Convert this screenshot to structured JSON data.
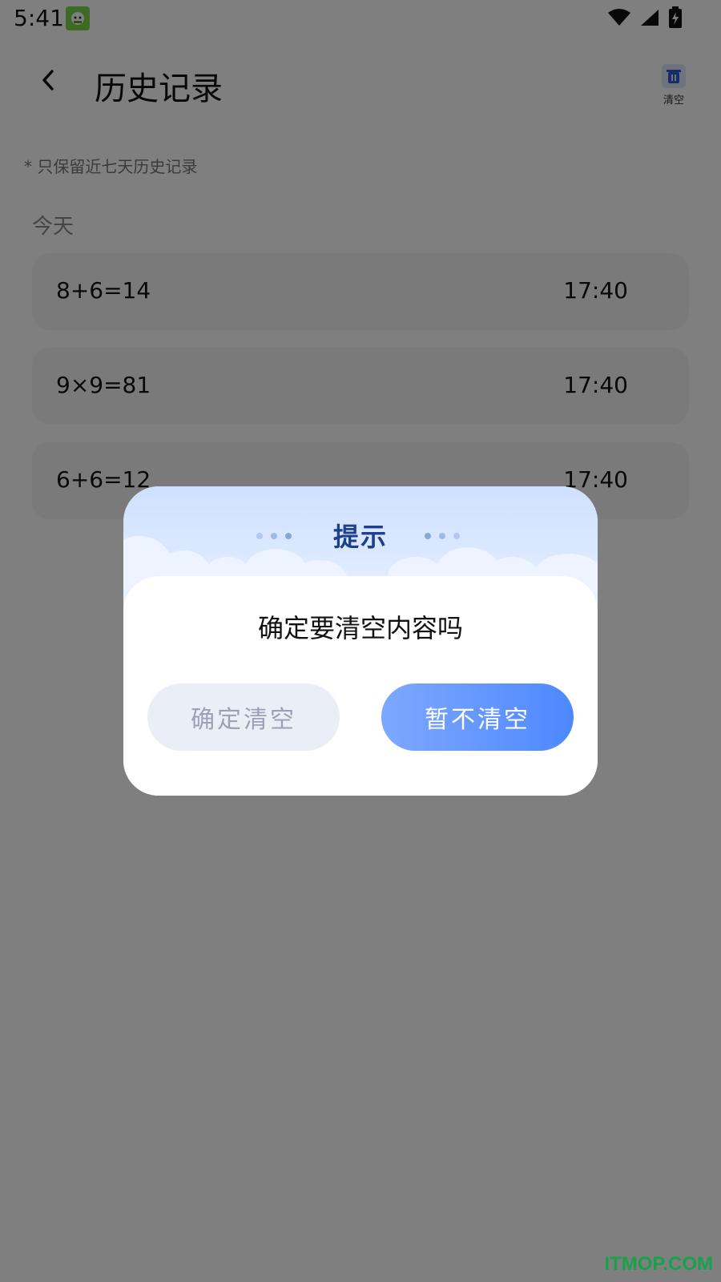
{
  "status_bar": {
    "time": "5:41",
    "icons": [
      "wifi-icon",
      "signal-icon",
      "battery-charging-icon"
    ]
  },
  "header": {
    "back_icon": "chevron-left-icon",
    "title": "历史记录",
    "clear_label": "清空",
    "clear_icon": "trash-icon"
  },
  "notice": "* 只保留近七天历史记录",
  "section_title": "今天",
  "records": [
    {
      "expression": "8+6=14",
      "time": "17:40"
    },
    {
      "expression": "9×9=81",
      "time": "17:40"
    },
    {
      "expression": "6+6=12",
      "time": "17:40"
    }
  ],
  "dialog": {
    "title": "提示",
    "message": "确定要清空内容吗",
    "confirm_label": "确定清空",
    "cancel_label": "暂不清空"
  },
  "watermark": "ITMOP.COM",
  "colors": {
    "overlay": "#808080",
    "dialog_title": "#1f3f8c",
    "primary_button": "#5a8fff",
    "secondary_button": "#eaeef6",
    "watermark": "#16a24b"
  }
}
